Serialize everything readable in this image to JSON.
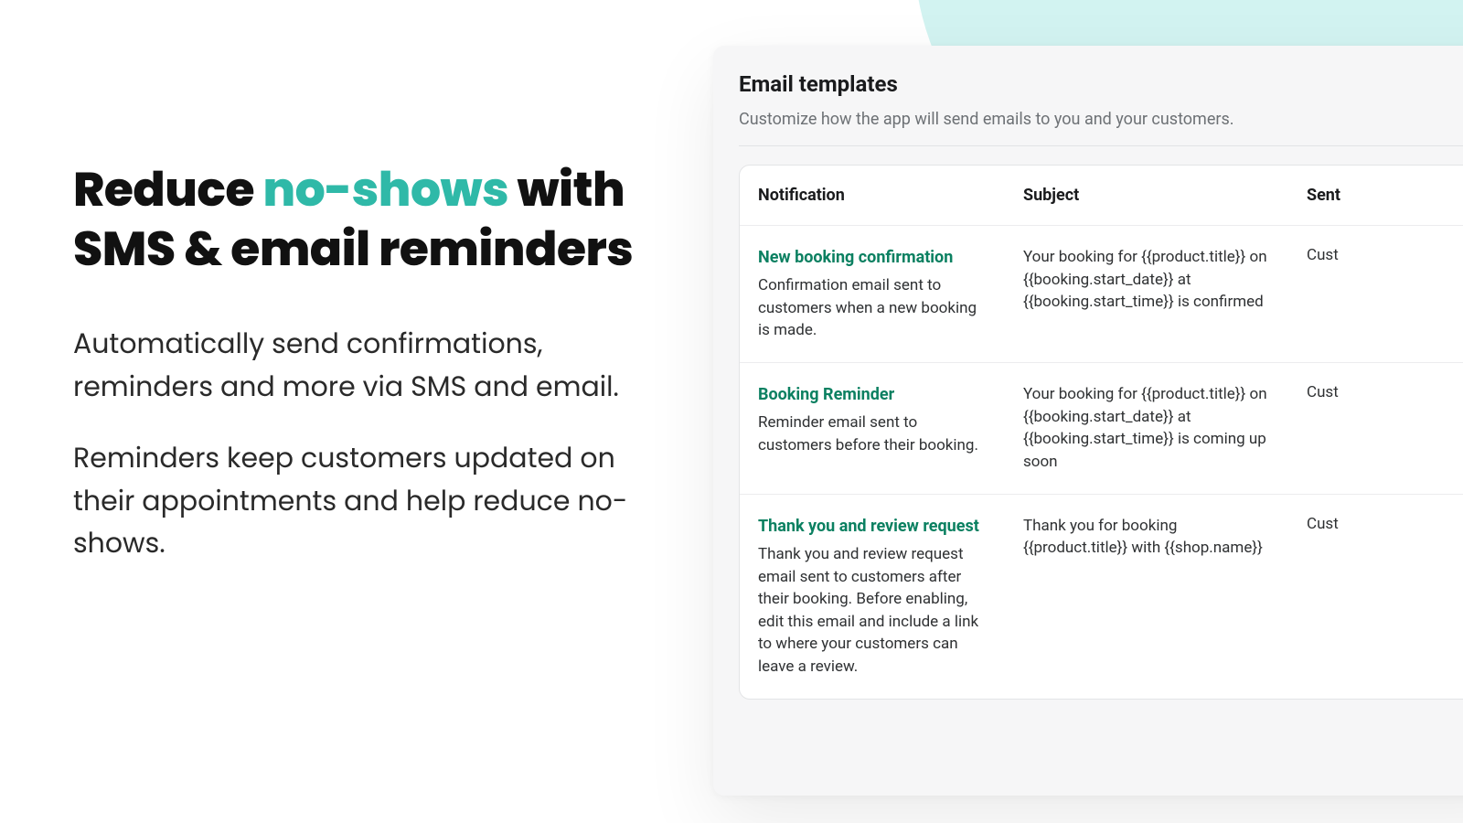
{
  "headline": {
    "pre": "Reduce ",
    "accent": "no-shows",
    "post": " with SMS & email reminders"
  },
  "paragraphs": {
    "p1": "Automatically send confirmations, reminders and more via SMS and email.",
    "p2": "Reminders keep customers updated on their appointments and help reduce no-shows."
  },
  "panel": {
    "title": "Email templates",
    "subtitle": "Customize how the app will send emails to you and your customers."
  },
  "table": {
    "headers": {
      "notification": "Notification",
      "subject": "Subject",
      "sent": "Sent"
    },
    "rows": [
      {
        "title": "New booking confirmation",
        "desc": "Confirmation email sent to customers when a new booking is made.",
        "subject": "Your booking for {{product.title}} on {{booking.start_date}} at {{booking.start_time}} is confirmed",
        "sent": "Cust"
      },
      {
        "title": "Booking Reminder",
        "desc": "Reminder email sent to customers before their booking.",
        "subject": "Your booking for {{product.title}} on {{booking.start_date}} at {{booking.start_time}} is coming up soon",
        "sent": "Cust"
      },
      {
        "title": "Thank you and review request",
        "desc": "Thank you and review request email sent to customers after their booking. Before enabling, edit this email and include a link to where your customers can leave a review.",
        "subject": "Thank you for booking {{product.title}} with {{shop.name}}",
        "sent": "Cust"
      }
    ]
  },
  "colors": {
    "accent": "#2fb9a8",
    "link": "#0b8061",
    "panelBg": "#f6f6f7"
  }
}
